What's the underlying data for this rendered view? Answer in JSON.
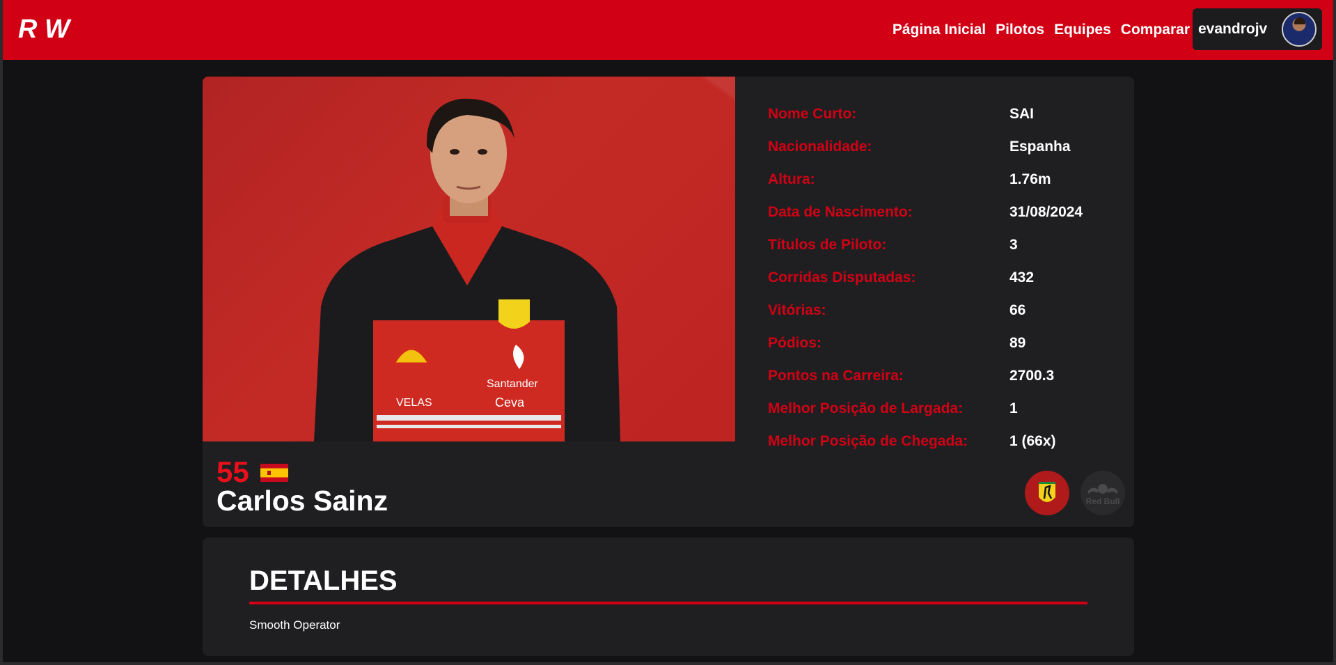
{
  "header": {
    "logo_text": "RW",
    "nav": [
      "Página Inicial",
      "Pilotos",
      "Equipes",
      "Comparar"
    ],
    "username": "evandrojv"
  },
  "driver": {
    "number": "55",
    "name": "Carlos Sainz",
    "country_flag": "Espanha",
    "stats": [
      {
        "label": "Nome Curto:",
        "value": "SAI"
      },
      {
        "label": "Nacionalidade:",
        "value": "Espanha"
      },
      {
        "label": "Altura:",
        "value": "1.76m"
      },
      {
        "label": "Data de Nascimento:",
        "value": "31/08/2024"
      },
      {
        "label": "Títulos de Piloto:",
        "value": "3"
      },
      {
        "label": "Corridas Disputadas:",
        "value": "432"
      },
      {
        "label": "Vitórias:",
        "value": "66"
      },
      {
        "label": "Pódios:",
        "value": "89"
      },
      {
        "label": "Pontos na Carreira:",
        "value": "2700.3"
      },
      {
        "label": "Melhor Posição de Largada:",
        "value": "1"
      },
      {
        "label": "Melhor Posição de Chegada:",
        "value": "1 (66x)"
      }
    ],
    "teams": [
      {
        "name": "Ferrari",
        "icon": "ferrari-logo-icon",
        "active": true
      },
      {
        "name": "Red Bull",
        "icon": "redbull-logo-icon",
        "active": false
      }
    ],
    "photo_text": [
      "Santander",
      "VELAS",
      "Ceva"
    ]
  },
  "details": {
    "title": "DETALHES",
    "text": "Smooth Operator"
  },
  "colors": {
    "accent": "#d10014",
    "background": "#121214",
    "card": "#1f1f22"
  }
}
